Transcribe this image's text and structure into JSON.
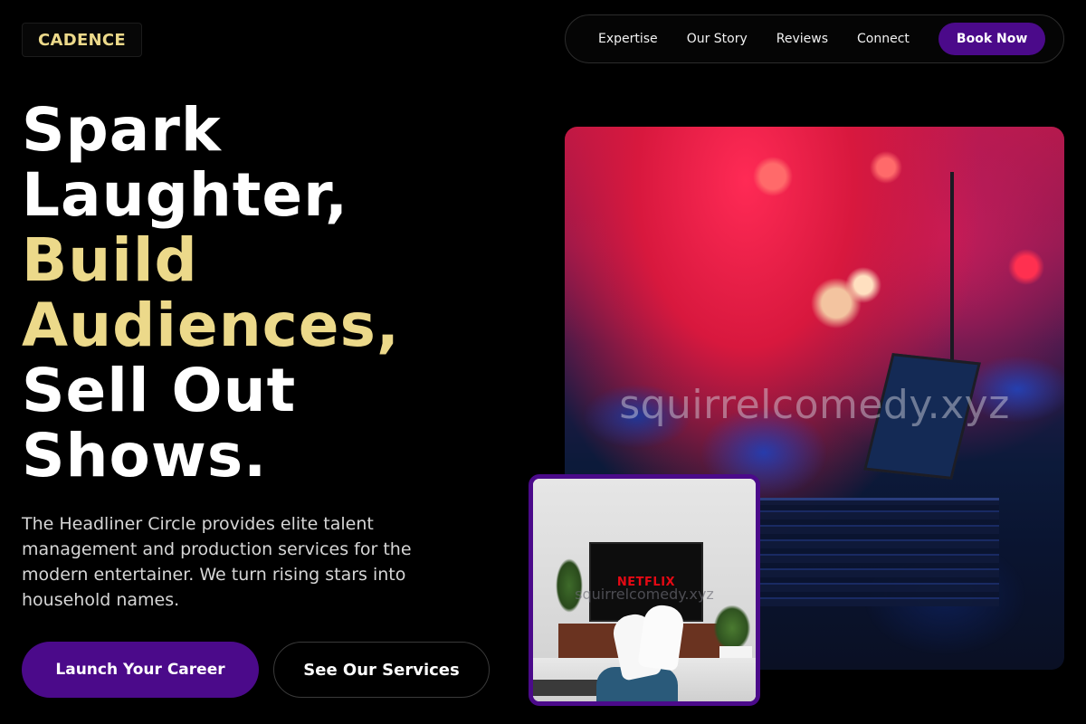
{
  "brand": {
    "logo": "CADENCE"
  },
  "nav": {
    "links": [
      "Expertise",
      "Our Story",
      "Reviews",
      "Connect"
    ],
    "cta": "Book Now"
  },
  "hero": {
    "title_line1": "Spark",
    "title_line2": "Laughter,",
    "title_line3": "Build",
    "title_line4": "Audiences,",
    "title_line5": "Sell Out",
    "title_line6": "Shows.",
    "description": "The Headliner Circle provides elite talent management and production services for the modern entertainer. We turn rising stars into household names.",
    "primary_cta": "Launch Your Career",
    "secondary_cta": "See Our Services"
  },
  "media": {
    "stage_watermark": "squirrelcomedy.xyz",
    "tv_watermark": "squirrelcomedy.xyz",
    "tv_brand": "NETFLIX"
  },
  "colors": {
    "accent_purple": "#4b0a8a",
    "accent_gold": "#ecd98a",
    "background": "#000000"
  }
}
